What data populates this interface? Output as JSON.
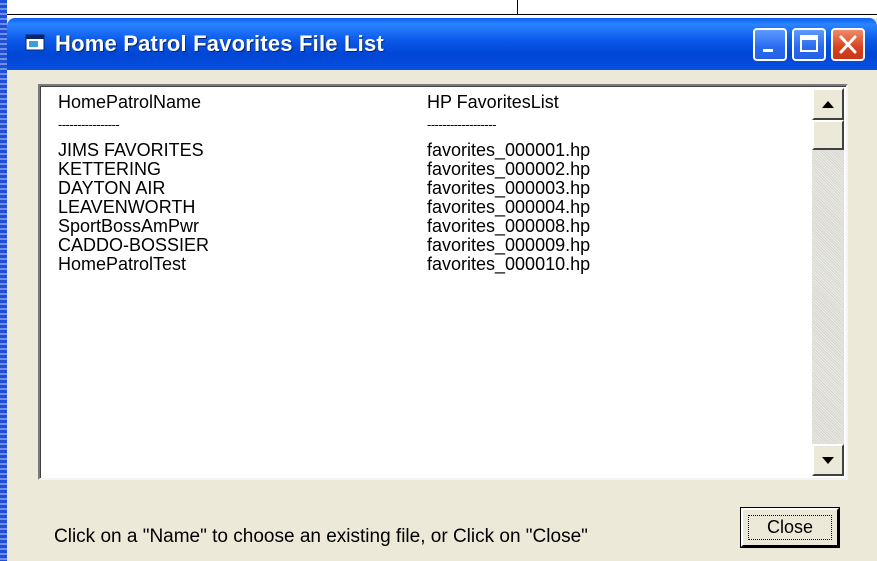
{
  "window": {
    "title": "Home Patrol Favorites File List"
  },
  "list": {
    "columns": [
      "HomePatrolName",
      "HP FavoritesList"
    ],
    "separators": [
      "----------------",
      "------------------"
    ],
    "rows": [
      {
        "name": "JIMS FAVORITES",
        "file": "favorites_000001.hp"
      },
      {
        "name": "KETTERING",
        "file": "favorites_000002.hp"
      },
      {
        "name": "DAYTON AIR",
        "file": "favorites_000003.hp"
      },
      {
        "name": "LEAVENWORTH",
        "file": "favorites_000004.hp"
      },
      {
        "name": "SportBossAmPwr",
        "file": "favorites_000008.hp"
      },
      {
        "name": "CADDO-BOSSIER",
        "file": "favorites_000009.hp"
      },
      {
        "name": "HomePatrolTest",
        "file": "favorites_000010.hp"
      }
    ]
  },
  "footer": {
    "hint": "Click on a \"Name\" to choose an existing file, or Click on \"Close\"",
    "close_label": "Close"
  },
  "icons": {
    "app": "window-app-icon",
    "minimize": "minimize-icon",
    "maximize": "maximize-icon",
    "close": "close-x-icon",
    "scroll_up": "arrow-up-icon",
    "scroll_down": "arrow-down-icon"
  },
  "colors": {
    "titlebar": "#0b56e8",
    "close_button": "#d8431d",
    "window_face": "#ece9d8"
  }
}
